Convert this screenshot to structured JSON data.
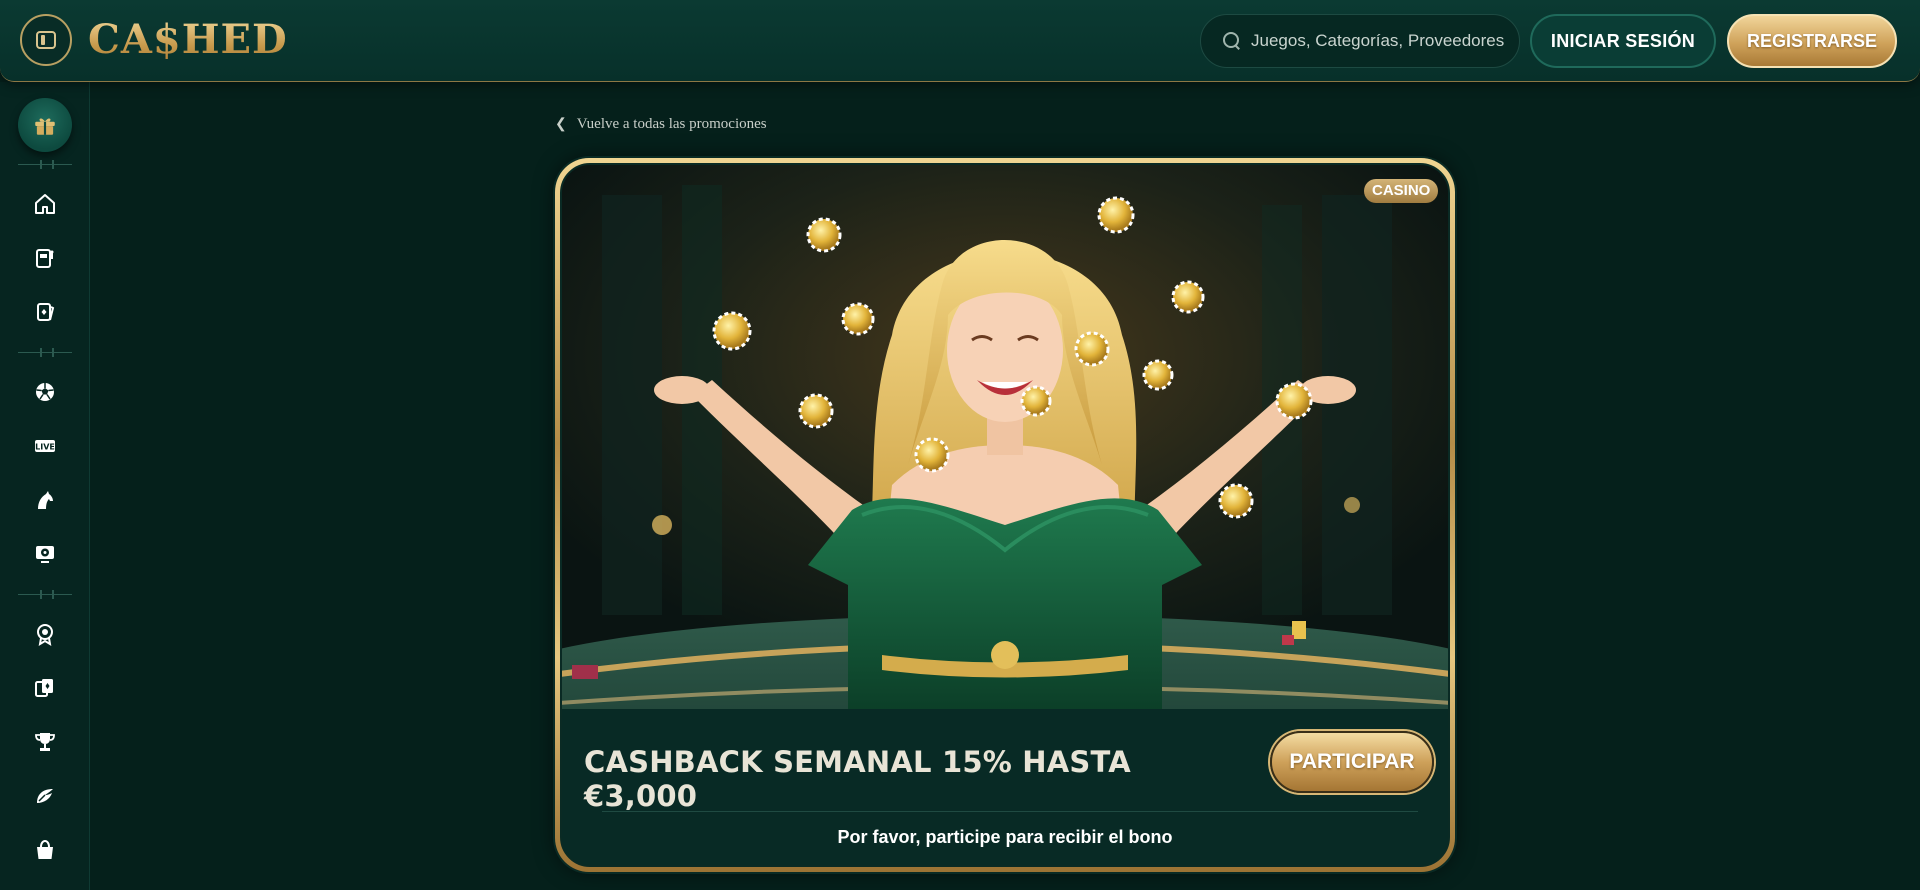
{
  "header": {
    "logo_text": "CA$HED",
    "search": {
      "placeholder": "Juegos, Categorías, Proveedores"
    },
    "login_label": "INICIAR SESIÓN",
    "register_label": "REGISTRARSE"
  },
  "sidebar": {
    "items": [
      {
        "icon": "gift-icon",
        "label": "Promociones"
      },
      {
        "icon": "home-icon",
        "label": "Inicio"
      },
      {
        "icon": "slot-machine-icon",
        "label": "Tragaperras"
      },
      {
        "icon": "cards-icon",
        "label": "Casino"
      },
      {
        "icon": "soccer-ball-icon",
        "label": "Deportes"
      },
      {
        "icon": "live-icon",
        "label": "Live",
        "text": "LIVE"
      },
      {
        "icon": "horse-icon",
        "label": "Carreras"
      },
      {
        "icon": "virtual-sports-icon",
        "label": "Virtuales"
      },
      {
        "icon": "badge-icon",
        "label": "VIP"
      },
      {
        "icon": "card-deck-icon",
        "label": "Mesa"
      },
      {
        "icon": "trophy-icon",
        "label": "Torneos"
      },
      {
        "icon": "sports-icon",
        "label": "Esports"
      },
      {
        "icon": "shop-bag-icon",
        "label": "Tienda"
      }
    ]
  },
  "breadcrumb": {
    "back_label": "Vuelve a todas las promociones"
  },
  "promo": {
    "badge": "CASINO",
    "title": "CASHBACK SEMANAL 15% HASTA €3,000",
    "cta_label": "PARTICIPAR",
    "note": "Por favor, participe para recibir el bono"
  },
  "colors": {
    "background": "#05201b",
    "header": "#0b3a32",
    "gold": "#cfa25a",
    "card_border": "#e6c77f"
  }
}
